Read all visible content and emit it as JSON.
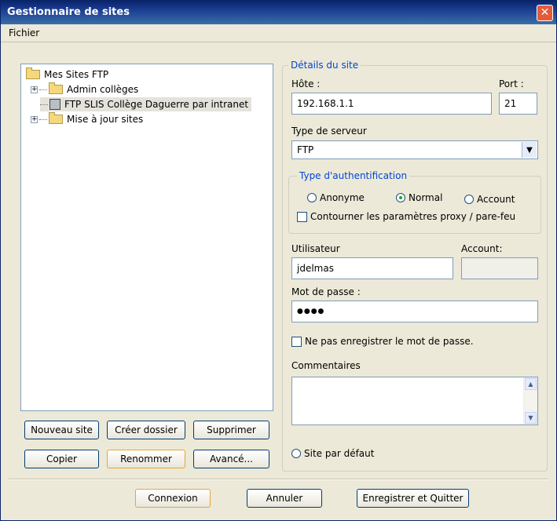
{
  "window": {
    "title": "Gestionnaire de sites",
    "close_glyph": "✕"
  },
  "menu": {
    "fichier": "Fichier"
  },
  "tree": {
    "root": "Mes Sites FTP",
    "items": [
      {
        "label": "Admin collèges",
        "expander": "+"
      },
      {
        "label": "FTP SLIS Collège Daguerre par intranet"
      },
      {
        "label": "Mise à jour sites",
        "expander": "+"
      }
    ]
  },
  "left_buttons": {
    "nouveau_site": "Nouveau site",
    "creer_dossier": "Créer dossier",
    "supprimer": "Supprimer",
    "copier": "Copier",
    "renommer": "Renommer",
    "avance": "Avancé..."
  },
  "details": {
    "title": "Détails du site",
    "hote_label": "Hôte :",
    "hote_value": "192.168.1.1",
    "port_label": "Port :",
    "port_value": "21",
    "type_serveur_label": "Type de serveur",
    "type_serveur_value": "FTP",
    "dropdown_glyph": "▼",
    "auth": {
      "title": "Type d'authentification",
      "anonyme": "Anonyme",
      "normal": "Normal",
      "account": "Account",
      "selected": "Normal",
      "proxy_label": "Contourner les paramètres proxy / pare-feu"
    },
    "utilisateur_label": "Utilisateur",
    "utilisateur_value": "jdelmas",
    "account_label": "Account:",
    "account_value": "",
    "mdp_label": "Mot de passe :",
    "mdp_value": "●●●●",
    "ne_pas_enregistrer_label": "Ne pas enregistrer le mot de passe.",
    "commentaires_label": "Commentaires",
    "commentaires_value": "",
    "scroll_up": "▲",
    "scroll_down": "▼",
    "site_defaut_label": "Site par défaut"
  },
  "footer": {
    "connexion": "Connexion",
    "annuler": "Annuler",
    "enregistrer": "Enregistrer et Quitter"
  }
}
